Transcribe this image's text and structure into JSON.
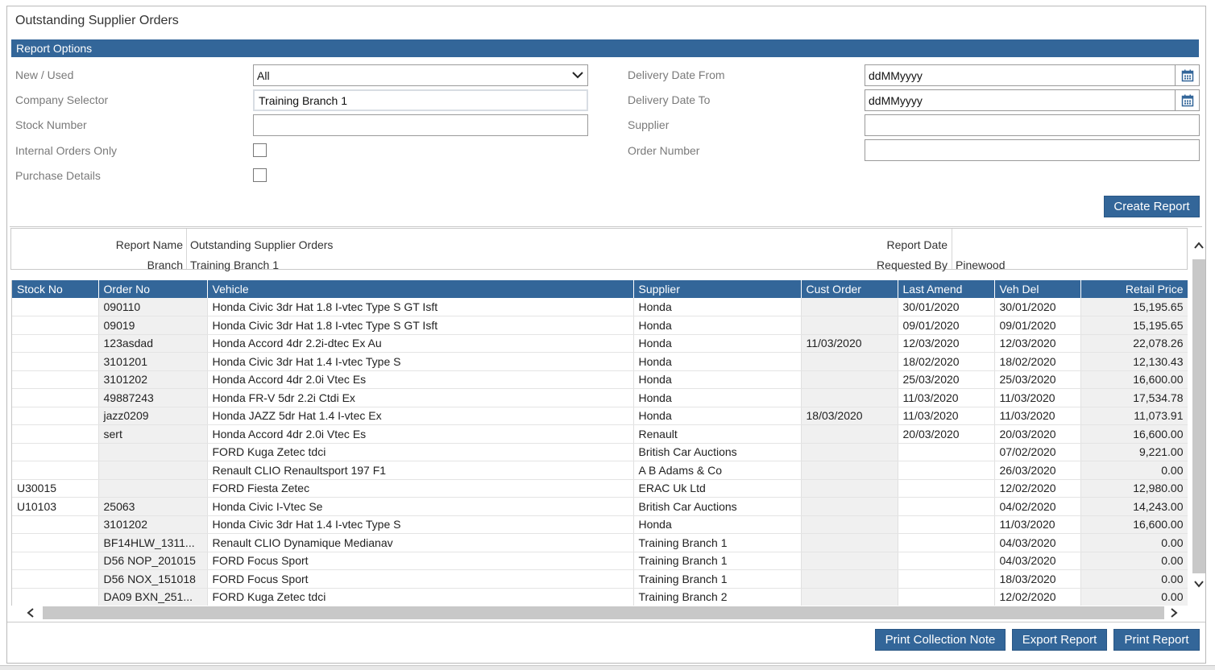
{
  "window_title": "Outstanding Supplier Orders",
  "report_options": {
    "header": "Report Options",
    "left": {
      "new_used_label": "New / Used",
      "new_used_value": "All",
      "company_label": "Company Selector",
      "company_value": "Training Branch 1",
      "stock_label": "Stock Number",
      "stock_value": "",
      "internal_label": "Internal Orders Only",
      "purchase_label": "Purchase Details"
    },
    "right": {
      "date_from_label": "Delivery Date From",
      "date_from_value": "ddMMyyyy",
      "date_to_label": "Delivery Date To",
      "date_to_value": "ddMMyyyy",
      "supplier_label": "Supplier",
      "supplier_value": "",
      "order_label": "Order Number",
      "order_value": ""
    },
    "create_button": "Create Report"
  },
  "report_info": {
    "report_name_label": "Report Name",
    "report_name_value": "Outstanding Supplier Orders",
    "branch_label": "Branch",
    "branch_value": "Training Branch 1",
    "report_date_label": "Report Date",
    "report_date_value": "",
    "requested_by_label": "Requested By",
    "requested_by_value": "Pinewood"
  },
  "table": {
    "columns": [
      "Stock No",
      "Order No",
      "Vehicle",
      "Supplier",
      "Cust Order",
      "Last Amend",
      "Veh Del",
      "Retail Price"
    ],
    "rows": [
      [
        "",
        "090110",
        "Honda Civic 3dr Hat 1.8 I-vtec Type S GT Isft",
        "Honda",
        "",
        "30/01/2020",
        "30/01/2020",
        "15,195.65"
      ],
      [
        "",
        "09019",
        "Honda Civic 3dr Hat 1.8 I-vtec Type S GT Isft",
        "Honda",
        "",
        "09/01/2020",
        "09/01/2020",
        "15,195.65"
      ],
      [
        "",
        "123asdad",
        "Honda Accord 4dr 2.2i-dtec Ex Au",
        "Honda",
        "11/03/2020",
        "12/03/2020",
        "12/03/2020",
        "22,078.26"
      ],
      [
        "",
        "3101201",
        "Honda Civic 3dr Hat 1.4 I-vtec Type S",
        "Honda",
        "",
        "18/02/2020",
        "18/02/2020",
        "12,130.43"
      ],
      [
        "",
        "3101202",
        "Honda Accord 4dr 2.0i Vtec Es",
        "Honda",
        "",
        "25/03/2020",
        "25/03/2020",
        "16,600.00"
      ],
      [
        "",
        "49887243",
        "Honda FR-V 5dr 2.2i Ctdi Ex",
        "Honda",
        "",
        "11/03/2020",
        "11/03/2020",
        "17,534.78"
      ],
      [
        "",
        "jazz0209",
        "Honda JAZZ 5dr Hat 1.4 I-vtec Ex",
        "Honda",
        "18/03/2020",
        "11/03/2020",
        "11/03/2020",
        "11,073.91"
      ],
      [
        "",
        "sert",
        "Honda Accord 4dr 2.0i Vtec Es",
        "Renault",
        "",
        "20/03/2020",
        "20/03/2020",
        "16,600.00"
      ],
      [
        "",
        "",
        "FORD Kuga Zetec tdci",
        "British Car Auctions",
        "",
        "",
        "07/02/2020",
        "9,221.00"
      ],
      [
        "",
        "",
        "Renault CLIO Renaultsport 197 F1",
        "A B Adams & Co",
        "",
        "",
        "26/03/2020",
        "0.00"
      ],
      [
        "U30015",
        "",
        "FORD Fiesta Zetec",
        "ERAC Uk Ltd",
        "",
        "",
        "12/02/2020",
        "12,980.00"
      ],
      [
        "U10103",
        "25063",
        "Honda Civic I-Vtec Se",
        "British Car Auctions",
        "",
        "",
        "04/02/2020",
        "14,243.00"
      ],
      [
        "",
        "3101202",
        "Honda Civic 3dr Hat 1.4 I-vtec Type S",
        "Honda",
        "",
        "",
        "11/03/2020",
        "16,600.00"
      ],
      [
        "",
        "BF14HLW_1311...",
        "Renault CLIO Dynamique Medianav",
        "Training Branch 1",
        "",
        "",
        "04/03/2020",
        "0.00"
      ],
      [
        "",
        "D56 NOP_201015",
        "FORD Focus Sport",
        "Training Branch 1",
        "",
        "",
        "04/03/2020",
        "0.00"
      ],
      [
        "",
        "D56 NOX_151018",
        "FORD Focus Sport",
        "Training Branch 1",
        "",
        "",
        "18/03/2020",
        "0.00"
      ],
      [
        "",
        "DA09 BXN_251...",
        "FORD Kuga Zetec tdci",
        "Training Branch 2",
        "",
        "",
        "12/02/2020",
        "0.00"
      ]
    ]
  },
  "footer_buttons": {
    "print_collection": "Print Collection Note",
    "export": "Export Report",
    "print": "Print Report"
  },
  "colors": {
    "accent": "#336699",
    "alt_row": "#f0f0f0"
  },
  "icons": [
    "chevron-down-icon",
    "calendar-icon",
    "scroll-up-icon",
    "scroll-down-icon",
    "scroll-left-icon",
    "scroll-right-icon"
  ]
}
